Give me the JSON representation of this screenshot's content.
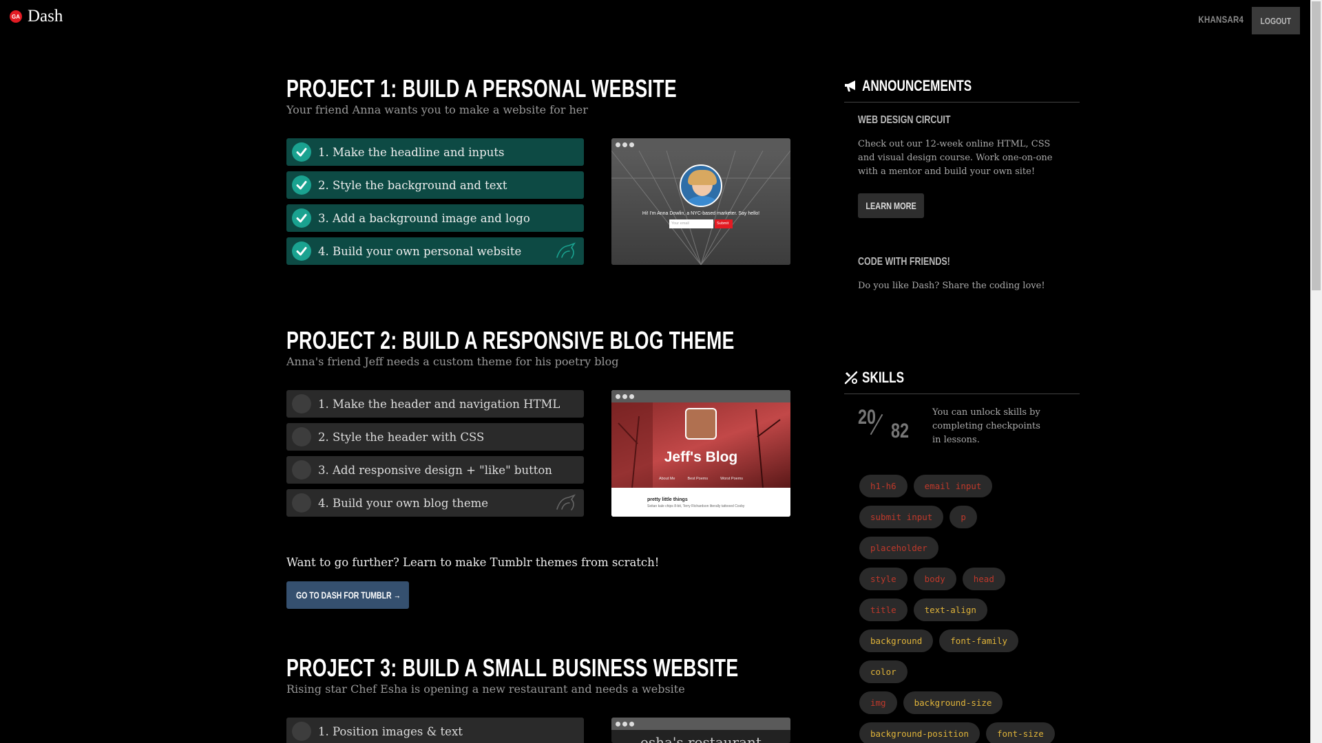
{
  "header": {
    "logo_badge": "GA",
    "app_name": "Dash",
    "username": "KHANSAR4",
    "logout_label": "LOGOUT"
  },
  "projects": [
    {
      "title": "PROJECT 1: BUILD A PERSONAL WEBSITE",
      "subtitle": "Your friend Anna wants you to make a website for her",
      "steps": [
        {
          "label": "1. Make the headline and inputs",
          "done": true
        },
        {
          "label": "2. Style the background and text",
          "done": true
        },
        {
          "label": "3. Add a background image and logo",
          "done": true
        },
        {
          "label": "4. Build your own personal website",
          "done": true
        }
      ],
      "preview": {
        "headline": "Hi! I'm Anna Dowlin, a NYC-based marketer. Say hello!",
        "email_placeholder": "Your email",
        "submit_label": "Submit"
      }
    },
    {
      "title": "PROJECT 2: BUILD A RESPONSIVE BLOG THEME",
      "subtitle": "Anna's friend Jeff needs a custom theme for his poetry blog",
      "steps": [
        {
          "label": "1. Make the header and navigation HTML",
          "done": false
        },
        {
          "label": "2. Style the header with CSS",
          "done": false
        },
        {
          "label": "3. Add responsive design + \"like\" button",
          "done": false
        },
        {
          "label": "4. Build your own blog theme",
          "done": false
        }
      ],
      "preview": {
        "blog_title": "Jeff's Blog",
        "nav": [
          "About Me",
          "Best Poems",
          "Worst Poems"
        ],
        "post_title": "pretty little things",
        "post_text": "Seitan kale chips 8-bit, Terry Richardson literally tattooed Cosby"
      }
    },
    {
      "title": "PROJECT 3: BUILD A SMALL BUSINESS WEBSITE",
      "subtitle": "Rising star Chef Esha is opening a new restaurant and needs a website",
      "steps": [
        {
          "label": "1. Position images & text",
          "done": false
        }
      ],
      "preview": {
        "heading": "esha's restaurant"
      }
    }
  ],
  "tumblr": {
    "text": "Want to go further? Learn to make Tumblr themes from scratch!",
    "button_label": "GO TO DASH FOR TUMBLR →"
  },
  "sidebar": {
    "announcements_title": "ANNOUNCEMENTS",
    "announcements": [
      {
        "title": "WEB DESIGN CIRCUIT",
        "body": "Check out our 12-week online HTML, CSS and visual design course. Work one-on-one with a mentor and build your own site!",
        "button_label": "LEARN MORE"
      },
      {
        "title": "CODE WITH FRIENDS!",
        "body": "Do you like Dash? Share the coding love!"
      }
    ],
    "skills_title": "SKILLS",
    "skills_unlocked": "20",
    "skills_total": "82",
    "skills_note": "You can unlock skills by completing checkpoints in lessons.",
    "skill_rows": [
      [
        {
          "name": "h1-h6",
          "color": "#c0392b"
        },
        {
          "name": "email input",
          "color": "#c0392b"
        }
      ],
      [
        {
          "name": "submit input",
          "color": "#c0392b"
        },
        {
          "name": "p",
          "color": "#c0392b"
        }
      ],
      [
        {
          "name": "placeholder",
          "color": "#c0392b"
        }
      ],
      [
        {
          "name": "style",
          "color": "#c0392b"
        },
        {
          "name": "body",
          "color": "#c0392b"
        },
        {
          "name": "head",
          "color": "#c0392b"
        }
      ],
      [
        {
          "name": "title",
          "color": "#c0392b"
        },
        {
          "name": "text-align",
          "color": "#e0b43a"
        }
      ],
      [
        {
          "name": "background",
          "color": "#e0b43a"
        },
        {
          "name": "font-family",
          "color": "#e0b43a"
        }
      ],
      [
        {
          "name": "color",
          "color": "#e0b43a"
        }
      ],
      [
        {
          "name": "img",
          "color": "#c0392b"
        },
        {
          "name": "background-size",
          "color": "#e0b43a"
        }
      ],
      [
        {
          "name": "background-position",
          "color": "#e0b43a"
        },
        {
          "name": "font-size",
          "color": "#e0b43a"
        }
      ]
    ]
  },
  "colors": {
    "done_step": "#0d4a44",
    "check_done": "#1aa290",
    "todo_step": "#2a2a2a",
    "tumblr_button": "#35506f",
    "logo_red": "#e31b23"
  }
}
